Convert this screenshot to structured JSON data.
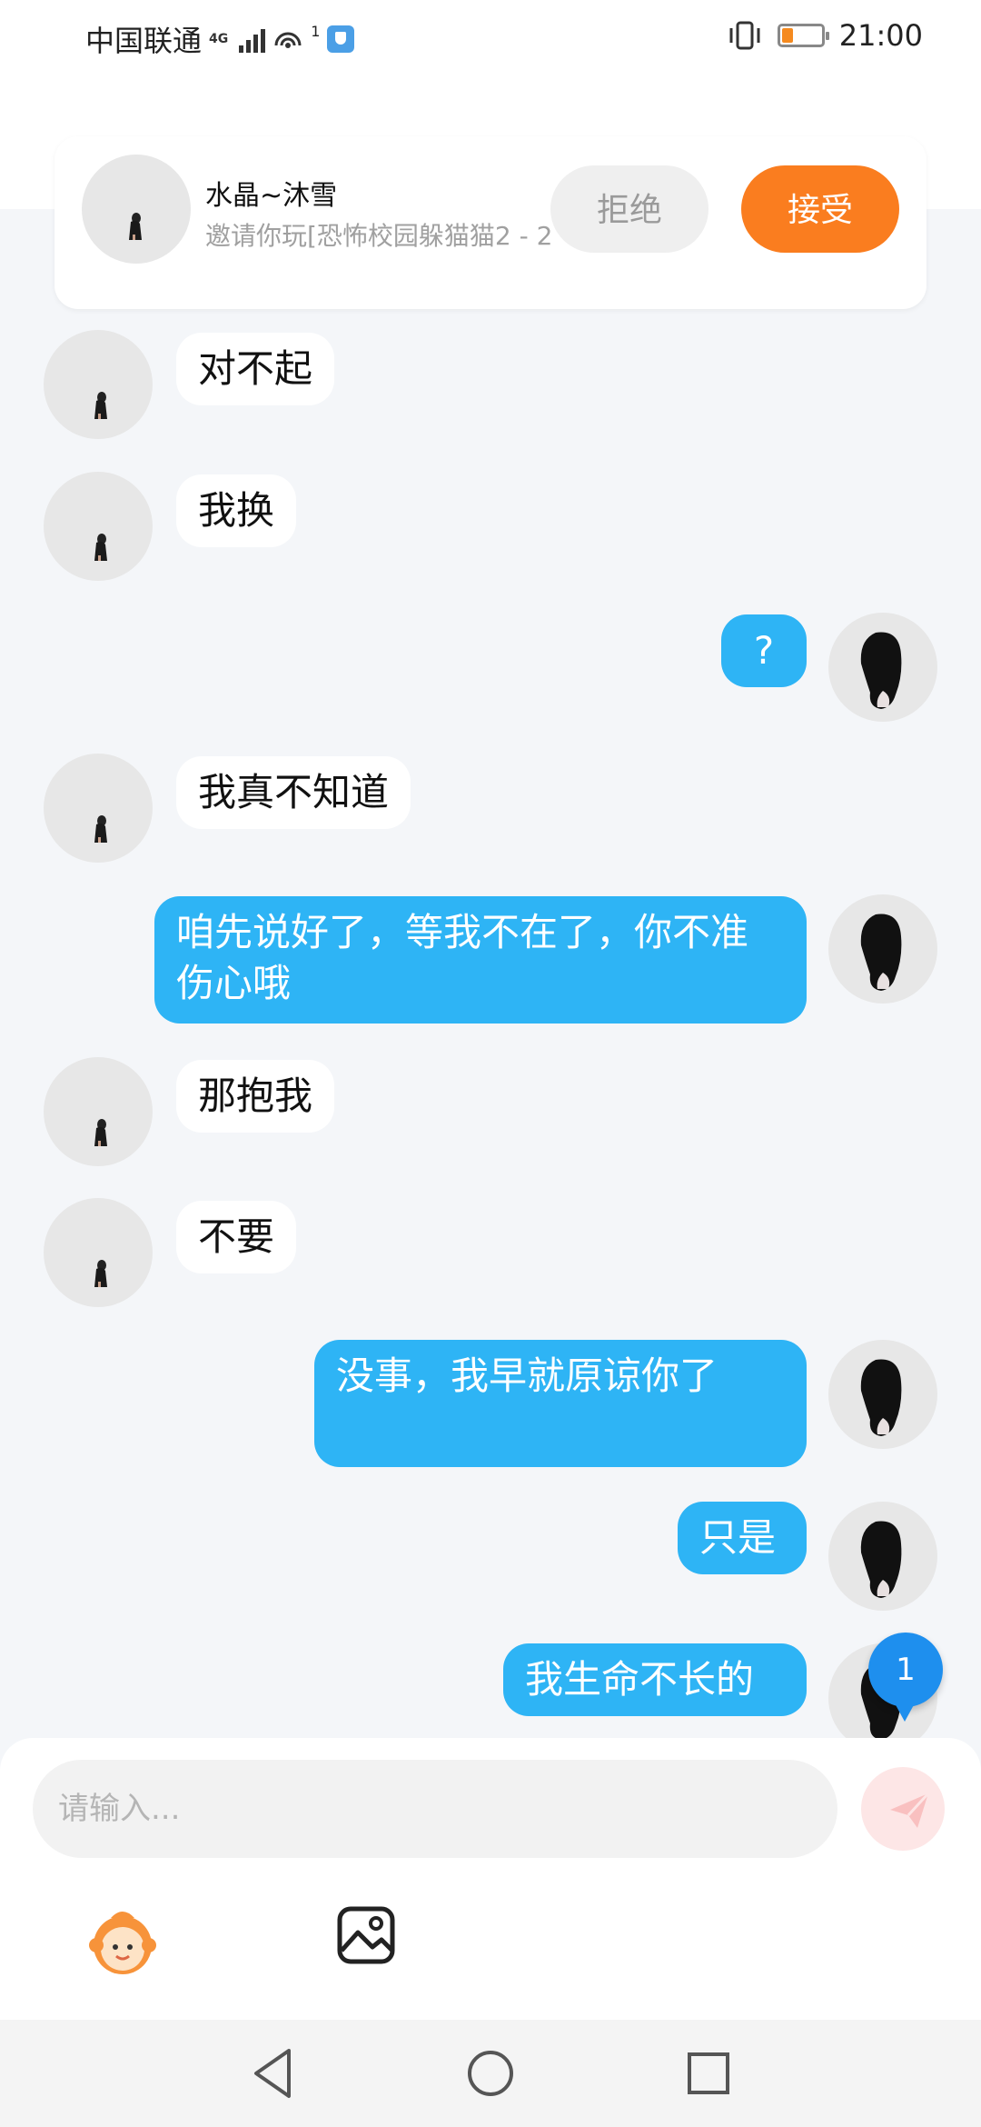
{
  "status_bar": {
    "carrier": "中国联通",
    "network": "4G",
    "sim_index": "1",
    "time": "21:00",
    "icons": [
      "signal-icon",
      "hotspot-icon",
      "shield-icon",
      "vibrate-icon",
      "battery-icon"
    ]
  },
  "invite": {
    "name": "水晶~沐雪",
    "description": "邀请你玩[恐怖校园躲猫猫2 - 2",
    "reject_label": "拒绝",
    "accept_label": "接受"
  },
  "messages": [
    {
      "side": "left",
      "text": "对不起"
    },
    {
      "side": "left",
      "text": "我换"
    },
    {
      "side": "right",
      "text": "?"
    },
    {
      "side": "left",
      "text": "我真不知道"
    },
    {
      "side": "right",
      "text": "咱先说好了，等我不在了，你不准伤心哦"
    },
    {
      "side": "left",
      "text": "那抱我"
    },
    {
      "side": "left",
      "text": "不要"
    },
    {
      "side": "right",
      "text": "没事，我早就原谅你了"
    },
    {
      "side": "right",
      "text": "只是"
    },
    {
      "side": "right",
      "text": "我生命不长的"
    }
  ],
  "unread_badge": "1",
  "composer": {
    "placeholder": "请输入...",
    "icons": [
      "send-icon",
      "emoji-icon",
      "image-icon"
    ]
  },
  "nav": {
    "icons": [
      "back-icon",
      "home-icon",
      "recents-icon"
    ]
  },
  "colors": {
    "accent_blue": "#2eb4f5",
    "accept_orange": "#fa7d1f",
    "background": "#f4f6f9"
  }
}
